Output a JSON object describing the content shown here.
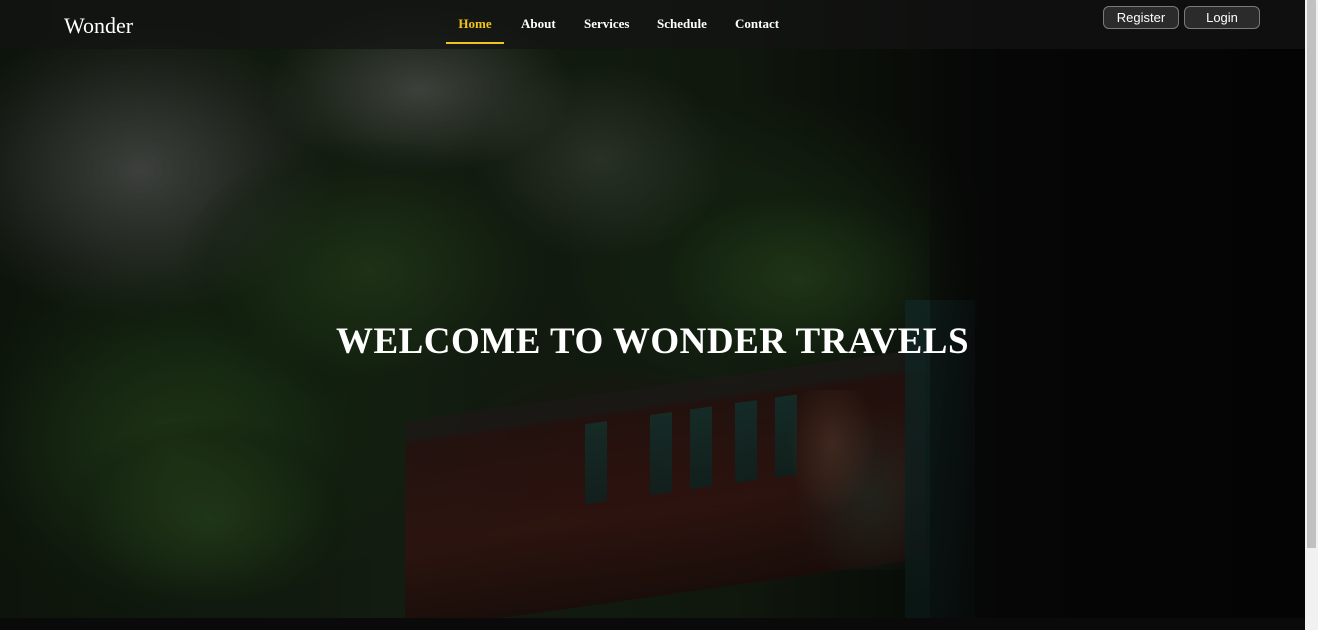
{
  "header": {
    "logo": "Wonder",
    "nav": [
      {
        "label": "Home",
        "active": true
      },
      {
        "label": "About",
        "active": false
      },
      {
        "label": "Services",
        "active": false
      },
      {
        "label": "Schedule",
        "active": false
      },
      {
        "label": "Contact",
        "active": false
      }
    ],
    "register_label": "Register",
    "login_label": "Login"
  },
  "hero": {
    "title": "WELCOME TO WONDER TRAVELS"
  },
  "colors": {
    "accent": "#f0c419",
    "header_bg": "#141414",
    "text": "#ffffff"
  }
}
